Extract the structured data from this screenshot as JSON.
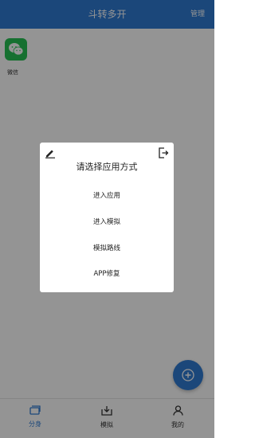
{
  "header": {
    "title": "斗转多开",
    "manage_label": "管理"
  },
  "apps": [
    {
      "label": "微信",
      "icon": "wechat-icon",
      "color": "#27c253"
    }
  ],
  "fab": {
    "icon": "plus-icon",
    "color": "#2f7bd3"
  },
  "bottom_nav": {
    "items": [
      {
        "label": "分身",
        "icon": "clone-icon",
        "active": true
      },
      {
        "label": "模拟",
        "icon": "simulate-icon",
        "active": false
      },
      {
        "label": "我的",
        "icon": "profile-icon",
        "active": false
      }
    ]
  },
  "dialog": {
    "title": "请选择应用方式",
    "options": [
      "进入应用",
      "进入模拟",
      "模拟路线",
      "APP修复"
    ],
    "edit_icon": "edit-icon",
    "exit_icon": "exit-icon"
  },
  "colors": {
    "primary": "#2f7bd3",
    "wechat": "#27c253"
  }
}
